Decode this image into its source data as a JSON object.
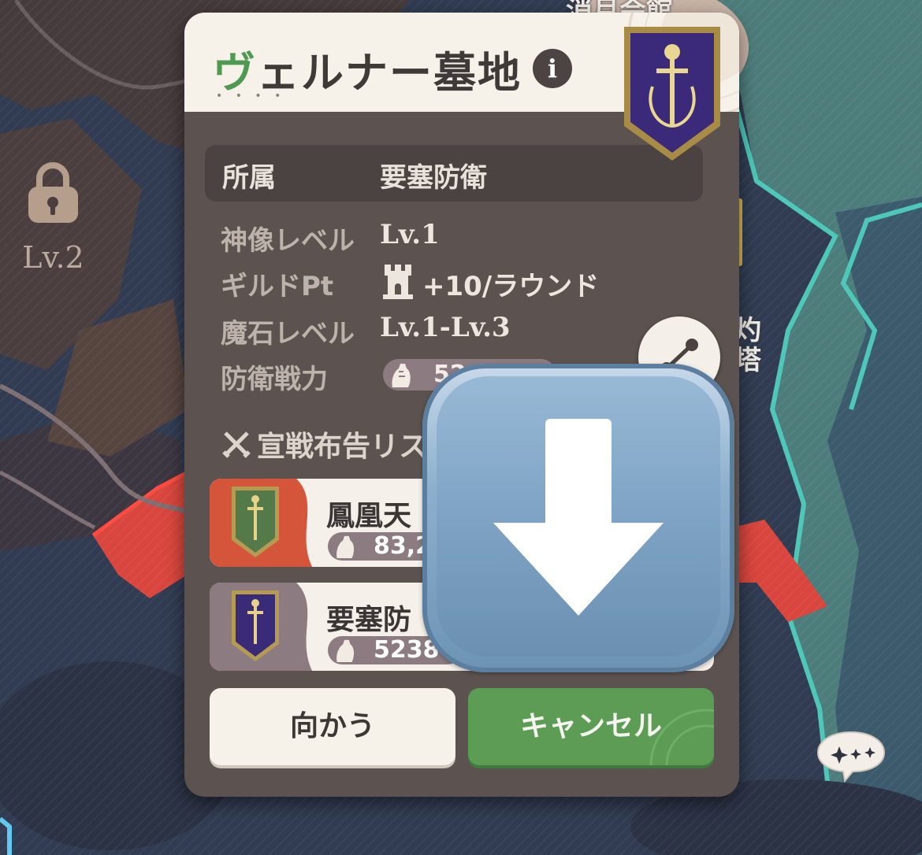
{
  "map": {
    "lock_label": "Lv.2",
    "top_label": "消月会館",
    "right_labels": [
      "灼",
      "塔"
    ]
  },
  "panel": {
    "title_first_char": "ヴ",
    "title_rest": "ェルナー墓地",
    "info_icon": "i",
    "affiliation": {
      "label": "所属",
      "value": "要塞防衛"
    },
    "rows": {
      "statue_level": {
        "label": "神像レベル",
        "value": "Lv.1"
      },
      "guild_pt": {
        "label": "ギルドPt",
        "value": "+10/ラウンド",
        "icon": "tower-icon"
      },
      "magic_stone": {
        "label": "魔石レベル",
        "value": "Lv.1-Lv.3"
      },
      "defense_power": {
        "label": "防衛戦力",
        "value": "52"
      }
    },
    "war_list_title": "宣戦布告リス",
    "war_list": [
      {
        "name": "鳳凰天",
        "power": "83,2",
        "color": "#d5553a"
      },
      {
        "name": "要塞防",
        "power": "5238",
        "color": "#8c7c82"
      }
    ],
    "buttons": {
      "go": "向かう",
      "cancel": "キャンセル"
    }
  },
  "overlay": {
    "icon": "down-arrow-emoji"
  },
  "colors": {
    "panel": "#5c5350",
    "header": "#f6f1e9",
    "accent_green": "#5c9c55",
    "title_green": "#4f9a52",
    "war_red": "#d5553a",
    "pill": "#8c7c82"
  }
}
